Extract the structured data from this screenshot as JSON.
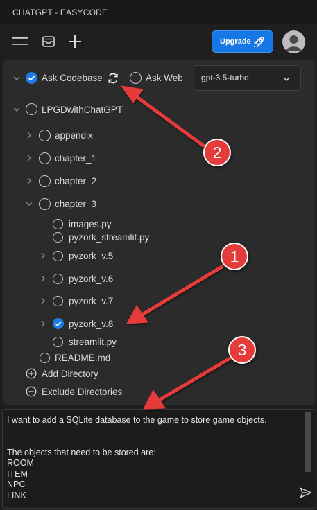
{
  "window": {
    "title": "CHATGPT - EASYCODE"
  },
  "toolbar": {
    "menu_icon": "hamburger-menu-icon",
    "archive_icon": "inbox-tray-icon",
    "new_icon": "plus-icon",
    "upgrade_label": "Upgrade",
    "upgrade_icon": "rocket-icon",
    "avatar_icon": "user-avatar-icon"
  },
  "options": {
    "ask_codebase": {
      "label": "Ask Codebase",
      "checked": true
    },
    "refresh_icon": "refresh-icon",
    "ask_web": {
      "label": "Ask Web",
      "checked": false
    },
    "model": {
      "selected": "gpt-3.5-turbo"
    }
  },
  "tree": {
    "root": {
      "label": "LPGDwithChatGPT"
    },
    "appendix": {
      "label": "appendix"
    },
    "chapter_1": {
      "label": "chapter_1"
    },
    "chapter_2": {
      "label": "chapter_2"
    },
    "chapter_3": {
      "label": "chapter_3"
    },
    "images": {
      "label": "images.py"
    },
    "pyzork_streamlit": {
      "label": "pyzork_streamlit.py"
    },
    "pyzork_v5": {
      "label": "pyzork_v.5"
    },
    "pyzork_v6": {
      "label": "pyzork_v.6"
    },
    "pyzork_v7": {
      "label": "pyzork_v.7"
    },
    "pyzork_v8": {
      "label": "pyzork_v.8",
      "checked": true
    },
    "streamlit": {
      "label": "streamlit.py"
    },
    "readme": {
      "label": "README.md"
    }
  },
  "actions": {
    "add_directory": "Add Directory",
    "exclude_directories": "Exclude Directories"
  },
  "chat": {
    "input_text": "I want to add a SQLite database to the game to store game objects.\n\n\nThe objects that need to be stored are:\nROOM\nITEM\nNPC\nLINK",
    "send_icon": "send-icon"
  },
  "annotations": {
    "badge_1": "1",
    "badge_2": "2",
    "badge_3": "3",
    "arrow_color": "#e53b3b"
  },
  "colors": {
    "accent": "#1e7ce8",
    "upgrade": "#1677e6",
    "panel": "#2b2b2b",
    "background": "#1f1f1f"
  }
}
